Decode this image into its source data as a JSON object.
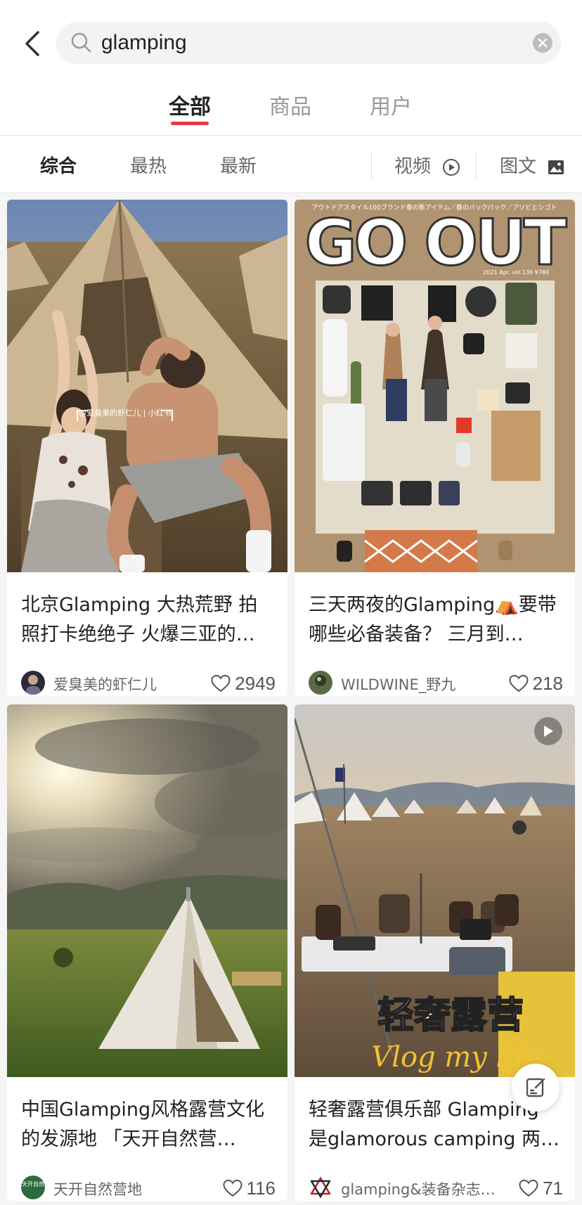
{
  "search": {
    "query": "glamping"
  },
  "tabs": [
    {
      "label": "全部",
      "active": true
    },
    {
      "label": "商品"
    },
    {
      "label": "用户"
    }
  ],
  "filters": {
    "sort": [
      {
        "label": "综合",
        "active": true
      },
      {
        "label": "最热"
      },
      {
        "label": "最新"
      }
    ],
    "video": {
      "label": "视频",
      "icon": "play-circle-icon"
    },
    "note": {
      "label": "图文",
      "icon": "image-icon"
    }
  },
  "cards": [
    {
      "title": "北京Glamping 大热荒野 拍照打卡绝绝子 火爆三亚的…",
      "author": "爱臭美的虾仁儿",
      "likes": "2949",
      "image_caption": "@爱臭美的虾仁儿 | 小红书"
    },
    {
      "title": "三天两夜的Glamping⛺要带哪些必备装备？ 三月到…",
      "author": "WILDWINE_野九",
      "likes": "218",
      "cover_title": "GO OUT",
      "cover_subtitle": "アウトドアスタイル100ブランド春の新アイテム／春のバックパック／アソビとシゴト",
      "cover_issue": "2021 Apr. vol.136 ¥780"
    },
    {
      "title": "中国Glamping风格露营文化的发源地 「天开自然营…",
      "author": "天开自然营地",
      "likes": "116",
      "avatar_text": "天开自然"
    },
    {
      "title": "轻奢露营俱乐部 Glamping 是glamorous camping 两…",
      "author": "glamping&装备杂志…",
      "likes": "71",
      "overlay_title": "轻奢露营",
      "overlay_script": "Vlog my life",
      "is_video": true
    }
  ],
  "colors": {
    "accent": "#e83a4b",
    "text": "#222222",
    "muted": "#999999"
  }
}
